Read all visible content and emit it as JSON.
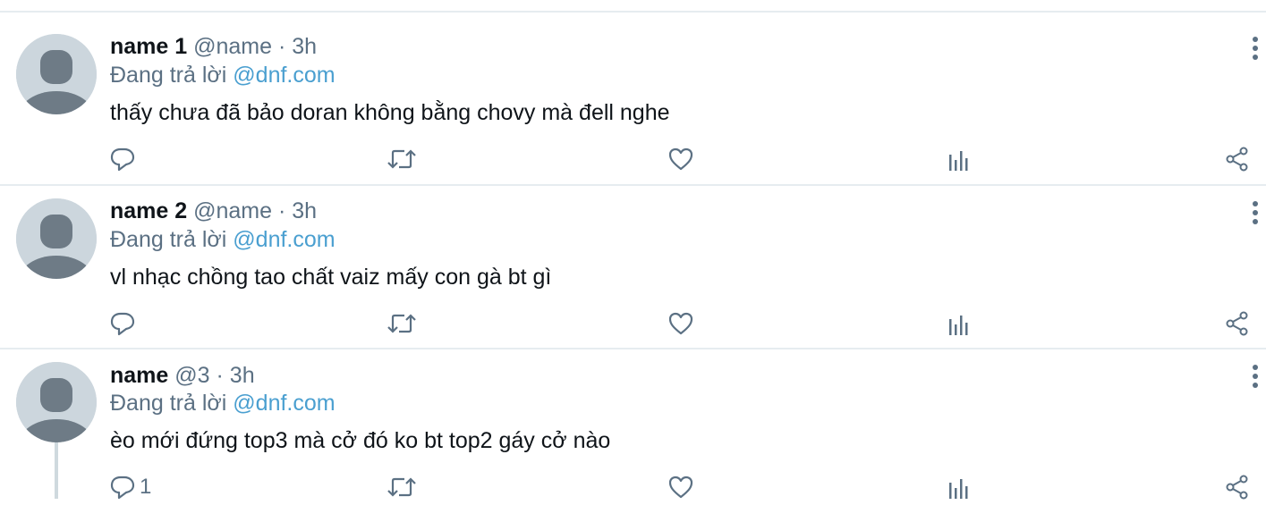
{
  "tweets": [
    {
      "name": "name 1",
      "handle": "@name",
      "separator": "·",
      "time": "3h",
      "reply_prefix": "Đang trả lời",
      "reply_to": "@dnf.com",
      "text": "thấy chưa đã bảo doran không bằng chovy mà đell nghe",
      "reply_count": ""
    },
    {
      "name": "name 2",
      "handle": "@name",
      "separator": "·",
      "time": "3h",
      "reply_prefix": "Đang trả lời",
      "reply_to": "@dnf.com",
      "text": "vl nhạc chồng tao chất vaiz mấy con gà bt gì",
      "reply_count": ""
    },
    {
      "name": "name",
      "handle": "@3",
      "separator": "·",
      "time": "3h",
      "reply_prefix": "Đang trả lời",
      "reply_to": "@dnf.com",
      "text": "èo mới đứng top3 mà cở đó ko bt top2 gáy cở nào",
      "reply_count": "1"
    }
  ],
  "icons": {
    "reply": "reply-icon",
    "retweet": "retweet-icon",
    "like": "heart-icon",
    "analytics": "analytics-icon",
    "share": "share-icon",
    "more": "more-vertical-icon"
  },
  "colors": {
    "text": "#0f1419",
    "secondary": "#5b7083",
    "link": "#4a9fd0",
    "divider": "#e6ecf0",
    "avatar_bg": "#ccd6dd",
    "avatar_figure": "#6e7b86"
  }
}
